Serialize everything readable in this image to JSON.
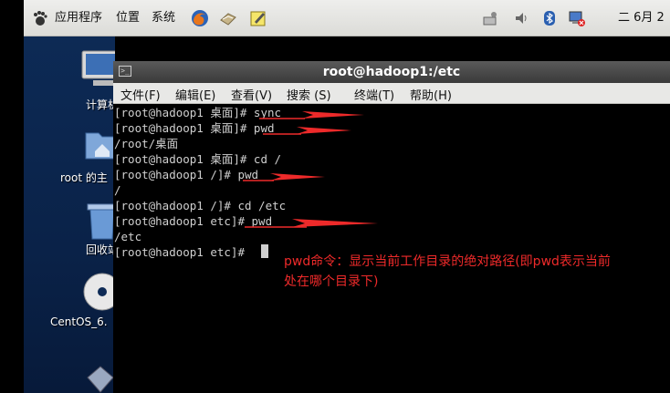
{
  "top_panel": {
    "apps_label": "应用程序",
    "places_label": "位置",
    "system_label": "系统",
    "clock": "二 6月  2"
  },
  "desktop": {
    "icons": [
      {
        "label": "计算机"
      },
      {
        "label": "root 的主"
      },
      {
        "label": "回收站"
      },
      {
        "label": "CentOS_6."
      }
    ]
  },
  "terminal": {
    "title": "root@hadoop1:/etc",
    "menu": [
      "文件(F)",
      "编辑(E)",
      "查看(V)",
      "搜索 (S)",
      "终端(T)",
      "帮助(H)"
    ],
    "lines": [
      "[root@hadoop1 桌面]# sync",
      "[root@hadoop1 桌面]# pwd",
      "/root/桌面",
      "[root@hadoop1 桌面]# cd /",
      "[root@hadoop1 /]# pwd",
      "/",
      "[root@hadoop1 /]# cd /etc",
      "[root@hadoop1 etc]# pwd",
      "/etc",
      "[root@hadoop1 etc]# "
    ],
    "annotation": [
      "pwd命令：显示当前工作目录的绝对路径(即pwd表示当前",
      "处在哪个目录下)"
    ]
  },
  "colors": {
    "annotation": "#ee2a2a",
    "terminal_bg": "#000000",
    "terminal_fg": "#cfcfcf",
    "desktop_bg": "#0d2a55"
  }
}
